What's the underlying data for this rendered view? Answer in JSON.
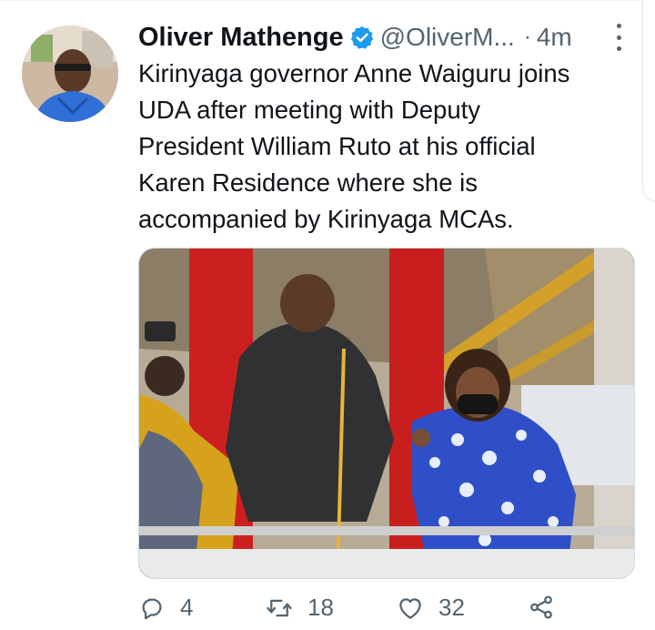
{
  "tweet": {
    "author_name": "Oliver Mathenge",
    "handle": "@OliverM...",
    "separator": "·",
    "time": "4m",
    "text": "Kirinyaga governor Anne Waiguru joins\nUDA after meeting with Deputy\nPresident William Ruto at his official\nKaren Residence where she is\naccompanied by Kirinyaga MCAs."
  },
  "actions": {
    "reply_count": "4",
    "retweet_count": "18",
    "like_count": "32"
  },
  "icons": {
    "verified": "verified-badge-icon",
    "more": "more-vertical-icon",
    "reply": "reply-icon",
    "retweet": "retweet-icon",
    "like": "heart-icon",
    "share": "share-icon"
  },
  "colors": {
    "text": "#0f1419",
    "secondary": "#536471",
    "verified": "#1d9bf0"
  }
}
